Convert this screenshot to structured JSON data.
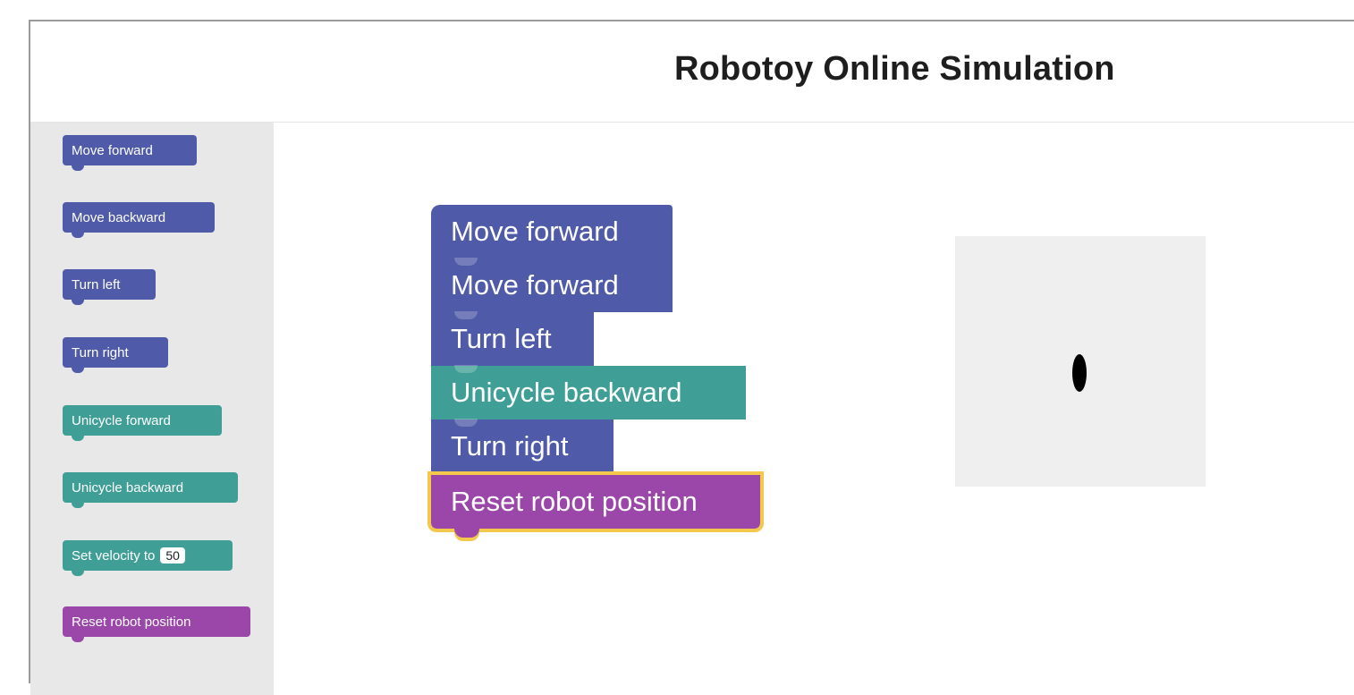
{
  "app": {
    "title": "Robotoy Online Simulation"
  },
  "colors": {
    "motion": "#4f5aa8",
    "unicycle": "#3f9f97",
    "reset": "#9b47a9",
    "highlight": "#f2c94c"
  },
  "toolbox": {
    "items": [
      {
        "label": "Move forward",
        "category": "motion"
      },
      {
        "label": "Move backward",
        "category": "motion"
      },
      {
        "label": "Turn left",
        "category": "motion"
      },
      {
        "label": "Turn right",
        "category": "motion"
      },
      {
        "label": "Unicycle forward",
        "category": "unicycle"
      },
      {
        "label": "Unicycle backward",
        "category": "unicycle"
      },
      {
        "label": "Set velocity to",
        "value": "50",
        "category": "unicycle"
      },
      {
        "label": "Reset robot position",
        "category": "reset"
      }
    ]
  },
  "workspace": {
    "program": [
      {
        "label": "Move forward",
        "category": "motion"
      },
      {
        "label": "Move forward",
        "category": "motion"
      },
      {
        "label": "Turn left",
        "category": "motion"
      },
      {
        "label": "Unicycle backward",
        "category": "unicycle"
      },
      {
        "label": "Turn right",
        "category": "motion"
      },
      {
        "label": "Reset robot position",
        "category": "reset",
        "selected": true
      }
    ]
  },
  "simulation": {
    "robot_icon": "robot-dot-icon"
  }
}
